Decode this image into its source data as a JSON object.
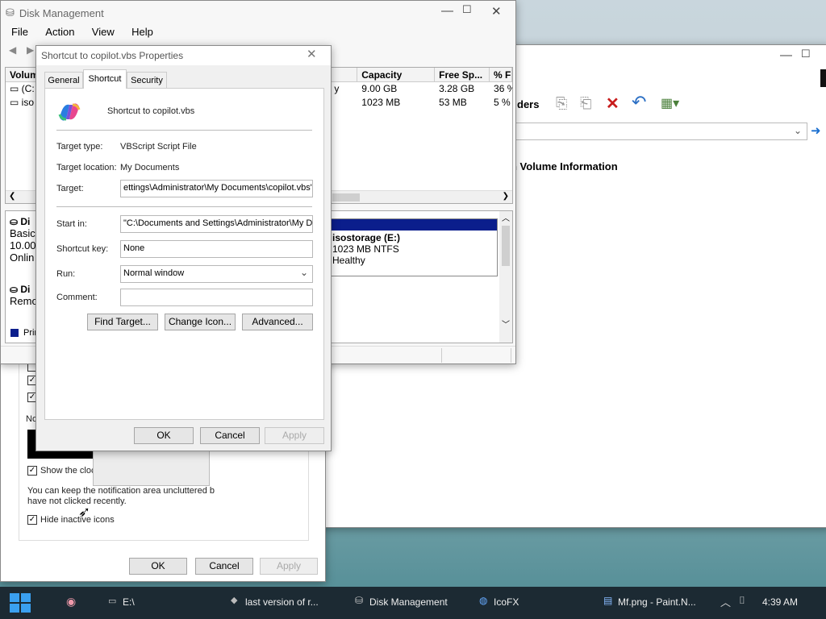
{
  "colors": {
    "accent": "#0b1e8c",
    "taskbar": "#1c2a33"
  },
  "disk_mgmt": {
    "title": "Disk Management",
    "menu": [
      "File",
      "Action",
      "View",
      "Help"
    ],
    "columns": [
      "Volum",
      "Capacity",
      "Free Sp...",
      "% Fr"
    ],
    "rows": [
      {
        "name": "(C:",
        "type": "y",
        "capacity": "9.00 GB",
        "free": "3.28 GB",
        "pct": "36 %"
      },
      {
        "name": "iso",
        "type": "",
        "capacity": "1023 MB",
        "free": "53 MB",
        "pct": "5 %"
      }
    ],
    "disk0": {
      "label": "Di",
      "type": "Basic",
      "size": "10.00",
      "status": "Onlin"
    },
    "disk1": {
      "label": "Di",
      "status": "Remo"
    },
    "legend_primary": "Prim",
    "volume": {
      "name": "isostorage  (E:)",
      "fs": "1023 MB NTFS",
      "health": "Healthy"
    }
  },
  "explorer": {
    "toolbar_text": "ders",
    "volume_info": "n Volume Information"
  },
  "taskbar_props": {
    "show_clock": "Show the cloc",
    "note_prefix": "No",
    "desc_line1": "You can keep the notification area uncluttered b",
    "desc_line2": "have not clicked recently.",
    "hide_inactive": "Hide inactive icons",
    "ok": "OK",
    "cancel": "Cancel",
    "apply": "Apply"
  },
  "props": {
    "title": "Shortcut to copilot.vbs Properties",
    "tabs": [
      "General",
      "Shortcut",
      "Security"
    ],
    "active_tab": "Shortcut",
    "name": "Shortcut to copilot.vbs",
    "target_type_label": "Target type:",
    "target_type": "VBScript Script File",
    "target_location_label": "Target location:",
    "target_location": "My Documents",
    "target_label": "Target:",
    "target": "ettings\\Administrator\\My Documents\\copilot.vbs\"",
    "start_in_label": "Start in:",
    "start_in": "\"C:\\Documents and Settings\\Administrator\\My Dc",
    "shortcut_key_label": "Shortcut key:",
    "shortcut_key": "None",
    "run_label": "Run:",
    "run": "Normal window",
    "comment_label": "Comment:",
    "comment": "",
    "find_target": "Find Target...",
    "change_icon": "Change Icon...",
    "advanced": "Advanced...",
    "ok": "OK",
    "cancel": "Cancel",
    "apply": "Apply"
  },
  "taskbar": {
    "items": [
      "E:\\",
      "last version of r...",
      "Disk Management",
      "IcoFX",
      "Mf.png - Paint.N..."
    ],
    "time": "4:39 AM"
  }
}
